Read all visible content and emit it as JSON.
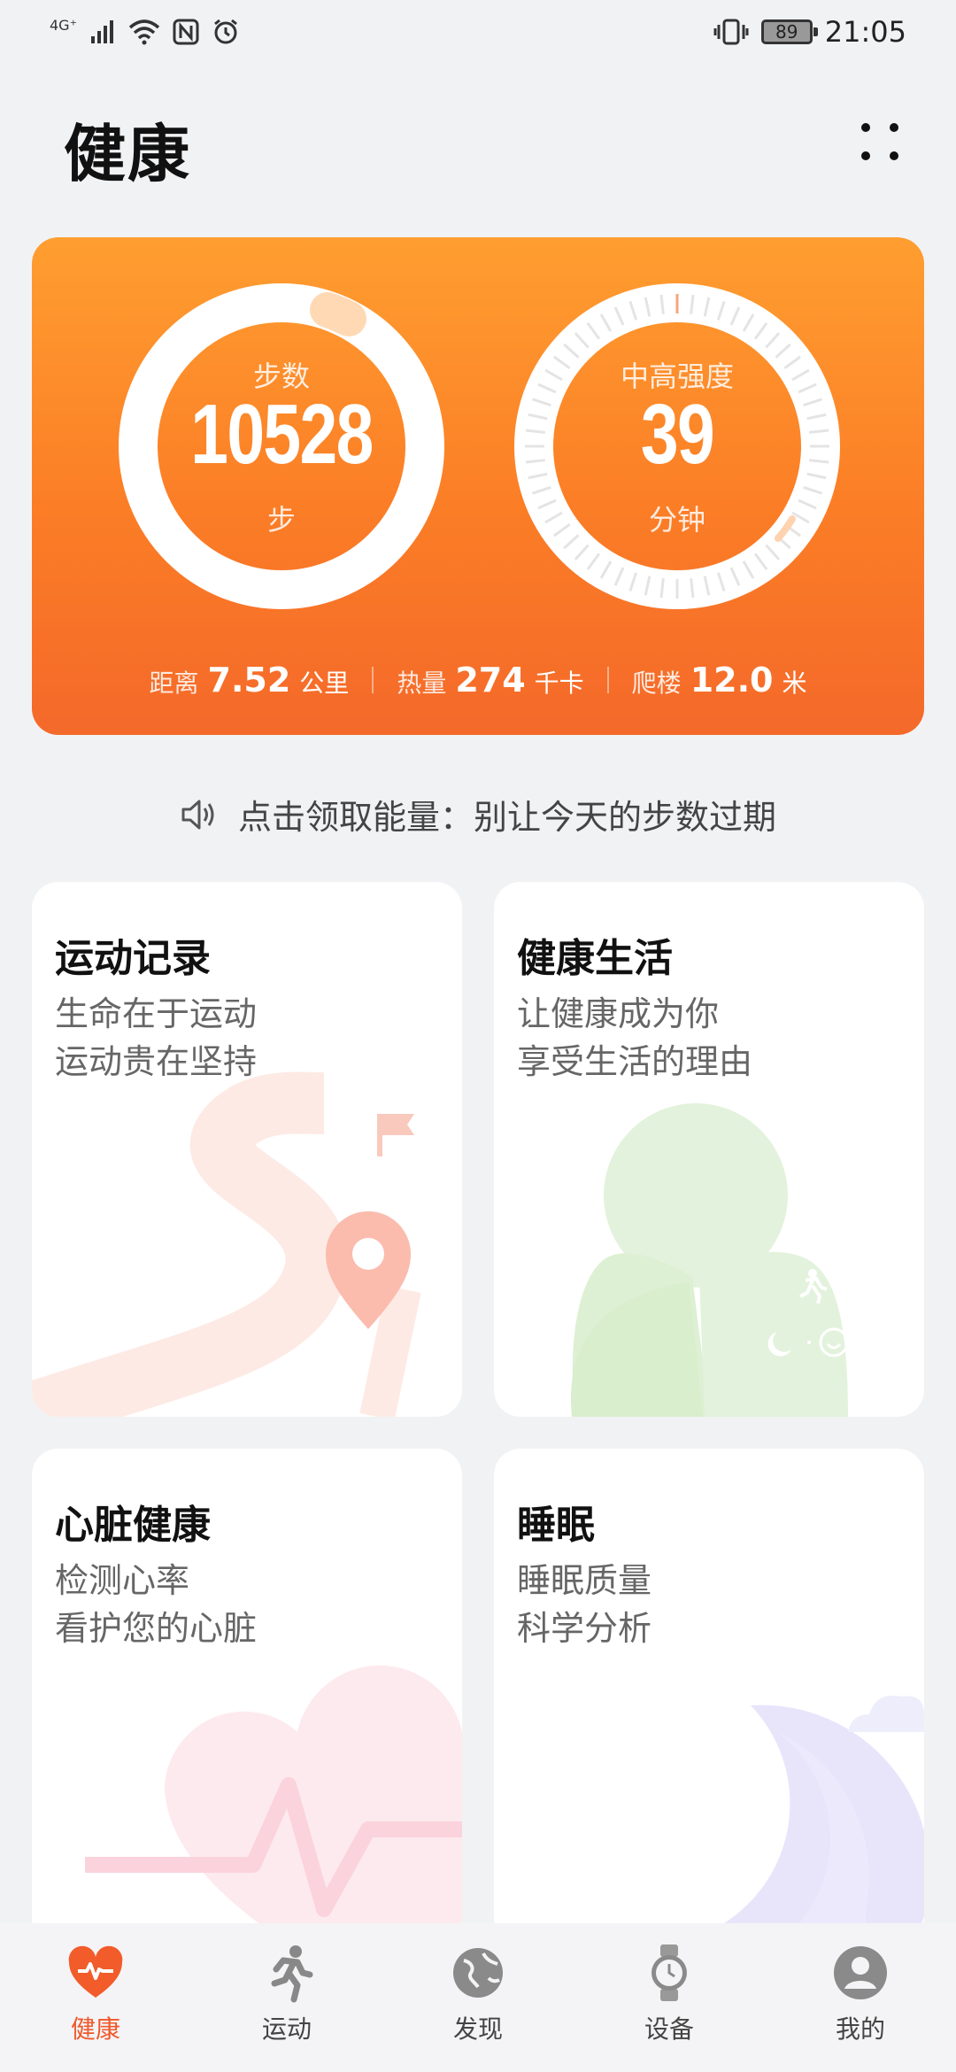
{
  "status_bar": {
    "network": "4G⁺",
    "battery": "89",
    "time": "21:05",
    "icons": [
      "signal-icon",
      "wifi-icon",
      "nfc-icon",
      "alarm-icon",
      "vibrate-icon",
      "battery-icon"
    ]
  },
  "header": {
    "title": "健康",
    "more_icon": "grid-dots-icon"
  },
  "summary": {
    "steps": {
      "label": "步数",
      "value": "10528",
      "unit": "步"
    },
    "intensity": {
      "label": "中高强度",
      "value": "39",
      "unit": "分钟"
    },
    "stats": [
      {
        "label": "距离",
        "value": "7.52",
        "unit": "公里"
      },
      {
        "label": "热量",
        "value": "274",
        "unit": "千卡"
      },
      {
        "label": "爬楼",
        "value": "12.0",
        "unit": "米"
      }
    ],
    "colors": {
      "gradient_top": "#ff9e30",
      "gradient_bottom": "#f4692a"
    }
  },
  "notice": {
    "icon": "speaker-icon",
    "text": "点击领取能量：别让今天的步数过期"
  },
  "cards": [
    {
      "title": "运动记录",
      "lines": [
        "生命在于运动",
        "运动贵在坚持"
      ],
      "illustration": "map-route-icon"
    },
    {
      "title": "健康生活",
      "lines": [
        "让健康成为你",
        "享受生活的理由"
      ],
      "illustration": "clover-lifestyle-icon"
    },
    {
      "title": "心脏健康",
      "lines": [
        "检测心率",
        "看护您的心脏"
      ],
      "illustration": "heart-pulse-icon"
    },
    {
      "title": "睡眠",
      "lines": [
        "睡眠质量",
        "科学分析"
      ],
      "illustration": "moon-icon"
    }
  ],
  "bottom_nav": [
    {
      "label": "健康",
      "icon": "heart-icon",
      "active": true
    },
    {
      "label": "运动",
      "icon": "runner-icon",
      "active": false
    },
    {
      "label": "发现",
      "icon": "globe-icon",
      "active": false
    },
    {
      "label": "设备",
      "icon": "watch-icon",
      "active": false
    },
    {
      "label": "我的",
      "icon": "profile-icon",
      "active": false
    }
  ]
}
